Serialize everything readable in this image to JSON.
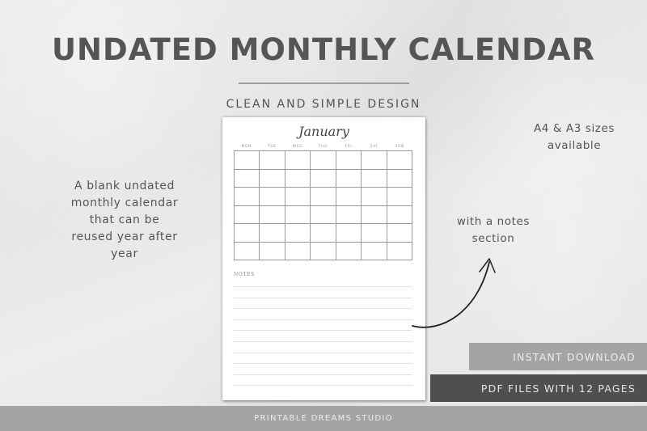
{
  "header": {
    "title": "UNDATED MONTHLY CALENDAR",
    "subtitle": "CLEAN AND SIMPLE DESIGN"
  },
  "calendar_page": {
    "month": "January",
    "weekdays": [
      "MON",
      "TUE",
      "WED",
      "THU",
      "FRI",
      "SAT",
      "SUN"
    ],
    "grid_rows": 6,
    "grid_columns": 7,
    "notes_label": "NOTES",
    "notes_line_count": 10
  },
  "callouts": {
    "left": "A blank undated monthly calendar that can be reused year after year",
    "sizes": "A4 & A3 sizes available",
    "notes": "with a notes section"
  },
  "badges": {
    "instant_download": "INSTANT DOWNLOAD",
    "pdf_files": "PDF FILES WITH 12 PAGES"
  },
  "footer": {
    "brand": "PRINTABLE DREAMS STUDIO"
  },
  "colors": {
    "title": "#555555",
    "divider": "#a49f94",
    "badge_light": "#a4a4a4",
    "badge_dark": "#4f4f4f",
    "footer_bg": "#a4a4a4",
    "background": "#e8e8e8"
  },
  "icons": {
    "arrow": "curved-arrow-icon"
  }
}
